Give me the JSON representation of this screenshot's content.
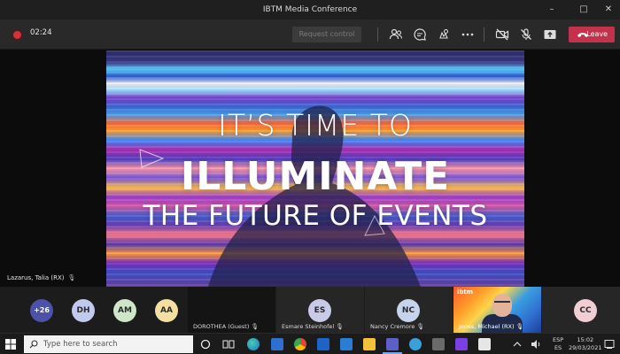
{
  "window": {
    "title": "IBTM Media Conference",
    "controls": [
      "–",
      "□",
      "✕"
    ]
  },
  "meeting": {
    "timer": "02:24",
    "request_control_label": "Request control",
    "leave_label": "Leave",
    "icons": [
      "participants-icon",
      "chat-icon",
      "reactions-icon",
      "more-options-icon",
      "camera-off-icon",
      "mic-off-icon",
      "share-tray-icon",
      "hangup-icon"
    ],
    "colors": {
      "leave": "#c4314b",
      "recording": "#d13438",
      "more_badge": "#4d51a8"
    }
  },
  "slide": {
    "line1": "IT’S TIME TO",
    "line2": "ILLUMINATE",
    "line3": "THE FUTURE OF EVENTS"
  },
  "stage": {
    "speaker_name": "Lazarus, Talia (RX)"
  },
  "participants": {
    "more_count": "+26",
    "avatars": [
      {
        "initials": "DH",
        "color": "#c2c9ee"
      },
      {
        "initials": "AM",
        "color": "#cfe6c9"
      },
      {
        "initials": "AA",
        "color": "#f3dfa2"
      }
    ],
    "tiles": [
      {
        "name": "DOROTHEA (Guest)",
        "initials": ""
      },
      {
        "name": "Esmare Steinhofel",
        "initials": "ES",
        "color": "#c9c9e8"
      },
      {
        "name": "Nancy Cremore",
        "initials": "NC",
        "color": "#c6d3ec"
      },
      {
        "name": "Jones, Michael (RX)",
        "initials": "",
        "video": true
      },
      {
        "name": "",
        "initials": "CC",
        "color": "#f1cdd4"
      }
    ],
    "video_logo": "ibtm"
  },
  "taskbar": {
    "search_placeholder": "Type here to search",
    "lang_top": "ESP",
    "lang_bottom": "ES",
    "time": "15:02",
    "date": "29/03/2021",
    "icons": [
      "start-icon",
      "search-icon",
      "task-view-icon",
      "edge-icon",
      "store-icon",
      "chrome-icon",
      "mail-icon",
      "explorer-icon",
      "settings-icon",
      "teams-icon",
      "app-icon",
      "app-icon-2",
      "app-icon-3",
      "app-icon-4",
      "notification-icon"
    ]
  }
}
